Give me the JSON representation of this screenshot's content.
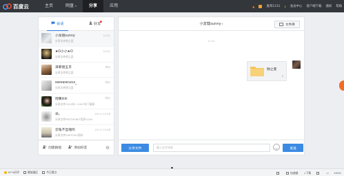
{
  "app": {
    "logo_text": "百度云",
    "brand_color": "#3b8be3"
  },
  "nav": {
    "items": [
      {
        "label": "主页",
        "active": false
      },
      {
        "label": "网盘",
        "active": false,
        "caret": "▾"
      },
      {
        "label": "分享",
        "active": true
      },
      {
        "label": "应用",
        "active": false
      }
    ]
  },
  "top_right": {
    "vip_text": "鬼哥1231",
    "badge": "v",
    "member": "会员中心",
    "client": "客户端下载",
    "notify": "通知",
    "help": "帮助"
  },
  "left_panel": {
    "tabs": [
      {
        "label": "会话",
        "icon": "chat-icon",
        "active": true
      },
      {
        "label": "好友",
        "icon": "user-icon",
        "active": false,
        "dot": true
      }
    ],
    "conversations": [
      {
        "name": "小龙辖sunny",
        "msg": "分享文件除之夏",
        "time": "10:51",
        "avatar_colors": [
          "#a9b4bc",
          "#e9ecef"
        ],
        "selected": true
      },
      {
        "name": "★O小小★O",
        "msg": "分享文件除之夏",
        "time": "10:51",
        "avatar_colors": [
          "#1d1d1d",
          "#d9c089"
        ]
      },
      {
        "name": "泽菲德五丰",
        "msg": "分享文件除之夏",
        "time": "昨天",
        "avatar_colors": [
          "#8c6240",
          "#e8d0b6"
        ]
      },
      {
        "name": "ReleaseSoul_",
        "msg": "分享文件除之夏",
        "time": "昨天",
        "avatar_colors": [
          "#ededed",
          "#bdbdbd"
        ]
      },
      {
        "name": "阿黄iiiiii",
        "msg": "分享文件2015年一1997年下载测",
        "time": "昨天",
        "avatar_colors": [
          "#161616",
          "#71c04a"
        ]
      },
      {
        "name": "朵。",
        "msg": "分享文件PATCHFNET程序4.0Vi",
        "time": "09-11 13:18",
        "avatar_colors": [
          "#dcdcdc",
          "#8e8e8e"
        ]
      },
      {
        "name": "云龟不显魂鸣",
        "msg": "分享文件EXEFCRU资料",
        "time": "09-11 13:48",
        "avatar_colors": [
          "#f0ead7",
          "#6a6a6a"
        ]
      }
    ],
    "footer": {
      "create_group": "创建群组",
      "add_friend": "添加好友"
    }
  },
  "chat": {
    "title": "小龙辖sunny",
    "title_caret": "▾",
    "file_lib": "文件库",
    "time": "11:51",
    "file_name": "除之夏",
    "share_button": "分享文件",
    "input_placeholder": "输入文字消息",
    "send_button": "发送"
  },
  "status_bar": {
    "left": [
      {
        "label": "67%好评",
        "color": "#f4b400"
      },
      {
        "label": "播放器区"
      },
      {
        "label": "今日看点"
      }
    ],
    "right": [
      {
        "label": ""
      },
      {
        "label": "加速器"
      },
      {
        "label": "下载"
      },
      {
        "label": ""
      },
      {
        "label": ""
      },
      {
        "label": "100%"
      }
    ]
  }
}
